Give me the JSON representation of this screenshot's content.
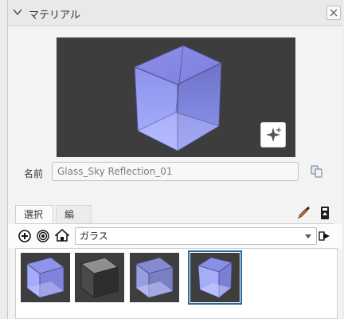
{
  "header": {
    "title": "マテリアル"
  },
  "preview": {
    "material": "Glass_Sky Reflection_01"
  },
  "name": {
    "label": "名前",
    "value": "Glass_Sky Reflection_01"
  },
  "tabs": [
    {
      "label": "選択",
      "active": true
    },
    {
      "label": "編集",
      "active": false
    }
  ],
  "library": {
    "selected": "ガラス"
  },
  "thumbnails": [
    {
      "name": "glass-blue-thumb",
      "selected": false
    },
    {
      "name": "glass-dark-thumb",
      "selected": false
    },
    {
      "name": "glass-blue-clear-thumb",
      "selected": false
    },
    {
      "name": "glass-sky-reflection-thumb",
      "selected": true
    }
  ],
  "colors": {
    "accent": "#2b6aa0",
    "glass": "#8f95f0"
  }
}
